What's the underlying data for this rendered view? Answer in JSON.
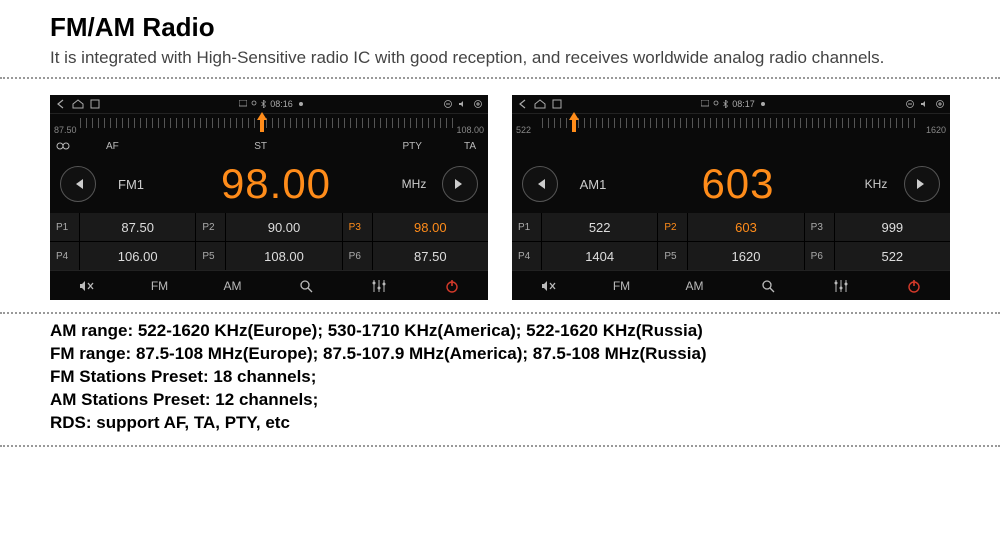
{
  "header": {
    "title": "FM/AM Radio",
    "subtitle": "It is integrated with High-Sensitive radio IC with good reception, and receives worldwide analog radio channels."
  },
  "fm": {
    "status_time": "08:16",
    "dial_min": "87.50",
    "dial_max": "108.00",
    "needle_pct": 48,
    "rds": {
      "af": "AF",
      "st": "ST",
      "pty": "PTY",
      "ta": "TA"
    },
    "band": "FM1",
    "freq": "98.00",
    "unit": "MHz",
    "presets": [
      {
        "n": "P1",
        "v": "87.50",
        "active": false
      },
      {
        "n": "P2",
        "v": "90.00",
        "active": false
      },
      {
        "n": "P3",
        "v": "98.00",
        "active": true
      },
      {
        "n": "P4",
        "v": "106.00",
        "active": false
      },
      {
        "n": "P5",
        "v": "108.00",
        "active": false
      },
      {
        "n": "P6",
        "v": "87.50",
        "active": false
      }
    ],
    "bottom": {
      "fm": "FM",
      "am": "AM"
    }
  },
  "am": {
    "status_time": "08:17",
    "dial_min": "522",
    "dial_max": "1620",
    "needle_pct": 7,
    "band": "AM1",
    "freq": "603",
    "unit": "KHz",
    "presets": [
      {
        "n": "P1",
        "v": "522",
        "active": false
      },
      {
        "n": "P2",
        "v": "603",
        "active": true
      },
      {
        "n": "P3",
        "v": "999",
        "active": false
      },
      {
        "n": "P4",
        "v": "1404",
        "active": false
      },
      {
        "n": "P5",
        "v": "1620",
        "active": false
      },
      {
        "n": "P6",
        "v": "522",
        "active": false
      }
    ],
    "bottom": {
      "fm": "FM",
      "am": "AM"
    }
  },
  "specs": {
    "l1": "AM range: 522-1620 KHz(Europe); 530-1710 KHz(America); 522-1620 KHz(Russia)",
    "l2": "FM range: 87.5-108 MHz(Europe); 87.5-107.9 MHz(America); 87.5-108 MHz(Russia)",
    "l3": "FM Stations Preset: 18 channels;",
    "l4": "AM Stations Preset: 12 channels;",
    "l5": "RDS: support AF, TA, PTY, etc"
  }
}
